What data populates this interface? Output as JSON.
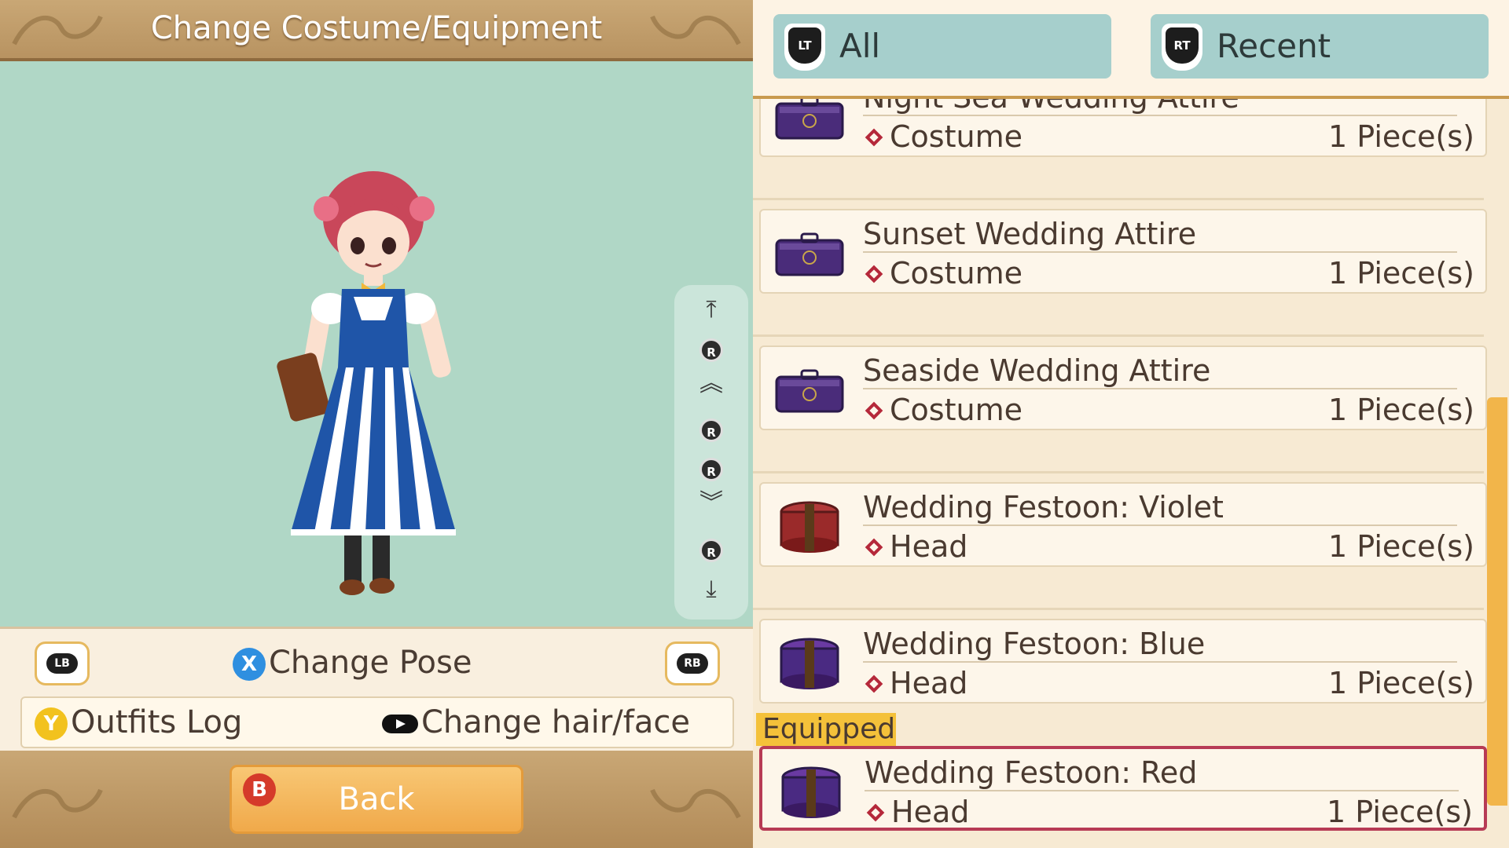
{
  "header": {
    "title": "Change Costume/Equipment"
  },
  "camera_controls": {
    "r_label": "R"
  },
  "controls": {
    "lb_label": "LB",
    "rb_label": "RB",
    "x_label": "X",
    "change_pose_label": "Change Pose",
    "y_label": "Y",
    "outfits_log_label": "Outfits Log",
    "change_hair_face_label": "Change hair/face"
  },
  "footer": {
    "b_label": "B",
    "back_label": "Back"
  },
  "tabs": [
    {
      "trigger": "LT",
      "label": "All"
    },
    {
      "trigger": "RT",
      "label": "Recent"
    }
  ],
  "items": [
    {
      "name": "Night Sea Wedding Attire",
      "type": "Costume",
      "count": "1 Piece(s)",
      "icon": "purple-suitcase-icon"
    },
    {
      "name": "Sunset Wedding Attire",
      "type": "Costume",
      "count": "1 Piece(s)",
      "icon": "purple-suitcase-icon"
    },
    {
      "name": "Seaside Wedding Attire",
      "type": "Costume",
      "count": "1 Piece(s)",
      "icon": "purple-suitcase-icon"
    },
    {
      "name": "Wedding Festoon: Violet",
      "type": "Head",
      "count": "1 Piece(s)",
      "icon": "red-hatbox-icon"
    },
    {
      "name": "Wedding Festoon: Blue",
      "type": "Head",
      "count": "1 Piece(s)",
      "icon": "purple-hatbox-icon"
    },
    {
      "name": "Wedding Festoon: Red",
      "type": "Head",
      "count": "1 Piece(s)",
      "icon": "purple-hatbox-icon"
    }
  ],
  "equipped_label": "Equipped",
  "colors": {
    "preview_bg": "#b0d7c6",
    "tab_bg": "#a6cfcc",
    "accent": "#f0a94a",
    "equipped": "#b73b55"
  }
}
